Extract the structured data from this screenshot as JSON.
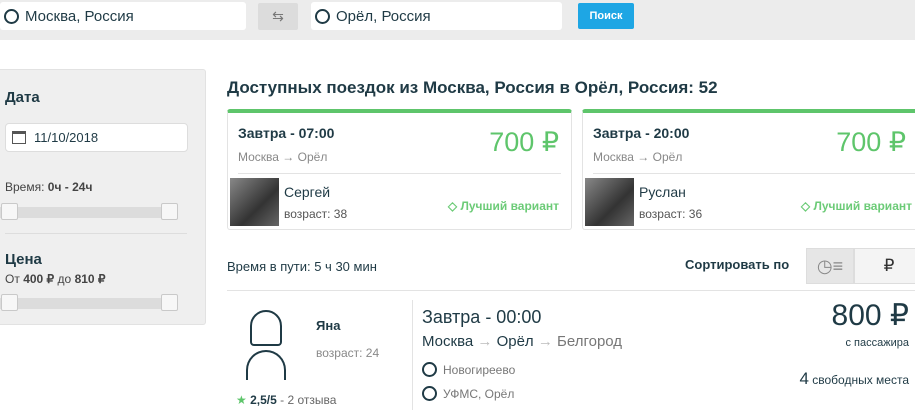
{
  "search": {
    "from": "Москва, Россия",
    "to": "Орёл, Россия",
    "swap_icon": "⇆",
    "button": "Поиск"
  },
  "filters": {
    "date_label": "Дата",
    "date_value": "11/10/2018",
    "time_prefix": "Время:",
    "time_from": "0ч",
    "time_sep": "-",
    "time_to": "24ч",
    "price_label": "Цена",
    "price_from_prefix": "От",
    "price_from": "400 ₽",
    "price_to_prefix": "до",
    "price_to": "810 ₽"
  },
  "results": {
    "heading": "Доступных поездок из Москва, Россия в Орёл, Россия: 52",
    "featured": [
      {
        "time": "Завтра - 07:00",
        "from": "Москва",
        "to": "Орёл",
        "price": "700 ₽",
        "driver": "Сергей",
        "age": "возраст: 38",
        "badge": "Лучший вариант"
      },
      {
        "time": "Завтра - 20:00",
        "from": "Москва",
        "to": "Орёл",
        "price": "700 ₽",
        "driver": "Руслан",
        "age": "возраст: 36",
        "badge": "Лучший вариант"
      }
    ],
    "duration": "Время в пути: 5 ч 30 мин",
    "sort_label": "Сортировать по",
    "sort_price": "₽",
    "listing": {
      "driver": "Яна",
      "age": "возраст: 24",
      "rating": "2,5/5",
      "reviews": "- 2 отзыва",
      "time": "Завтра - 00:00",
      "route": [
        "Москва",
        "Орёл",
        "Белгород"
      ],
      "stops": [
        "Новогиреево",
        "УФМС, Орёл"
      ],
      "price": "800 ₽",
      "price_note": "с пассажира",
      "seats_count": "4",
      "seats_label": "свободных места"
    }
  },
  "colors": {
    "accent": "#5ec56b",
    "button": "#1ea6e4",
    "text": "#1f3a45"
  }
}
